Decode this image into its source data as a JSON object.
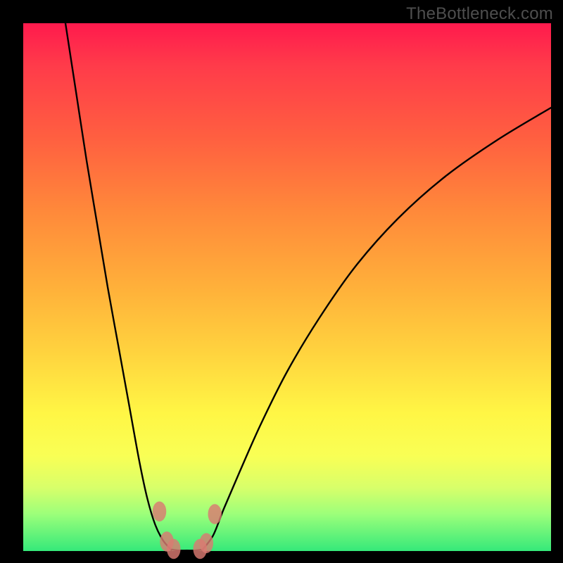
{
  "watermark": "TheBottleneck.com",
  "colors": {
    "frame": "#000000",
    "gradient_top": "#ff1a4d",
    "gradient_bottom": "#35e97a",
    "curve": "#000000",
    "marker": "#d97a72"
  },
  "chart_data": {
    "type": "line",
    "title": "",
    "xlabel": "",
    "ylabel": "",
    "xlim": [
      0,
      100
    ],
    "ylim": [
      0,
      100
    ],
    "series": [
      {
        "name": "left-branch",
        "x": [
          8,
          10,
          12,
          14,
          16,
          18,
          20,
          22,
          23.5,
          25,
          26.5,
          28
        ],
        "y": [
          100,
          87,
          74,
          62,
          50,
          39,
          28,
          17,
          10,
          5,
          2,
          0.3
        ]
      },
      {
        "name": "valley-floor",
        "x": [
          28,
          29.5,
          31,
          32.5,
          34
        ],
        "y": [
          0.3,
          0.1,
          0.1,
          0.1,
          0.3
        ]
      },
      {
        "name": "right-branch",
        "x": [
          34,
          36,
          38,
          41,
          45,
          50,
          56,
          63,
          71,
          80,
          90,
          100
        ],
        "y": [
          0.3,
          3,
          8,
          15,
          24,
          34,
          44,
          54,
          63,
          71,
          78,
          84
        ]
      }
    ],
    "markers": [
      {
        "x": 25.8,
        "y": 7.5
      },
      {
        "x": 27.2,
        "y": 1.8
      },
      {
        "x": 28.5,
        "y": 0.4
      },
      {
        "x": 33.5,
        "y": 0.4
      },
      {
        "x": 34.7,
        "y": 1.5
      },
      {
        "x": 36.3,
        "y": 7.0
      }
    ],
    "marker_rx": 1.3,
    "marker_ry": 1.9,
    "background_gradient": {
      "top": "#ff1a4d",
      "bottom": "#35e97a",
      "meaning": "red=high bottleneck, green=low bottleneck"
    }
  }
}
